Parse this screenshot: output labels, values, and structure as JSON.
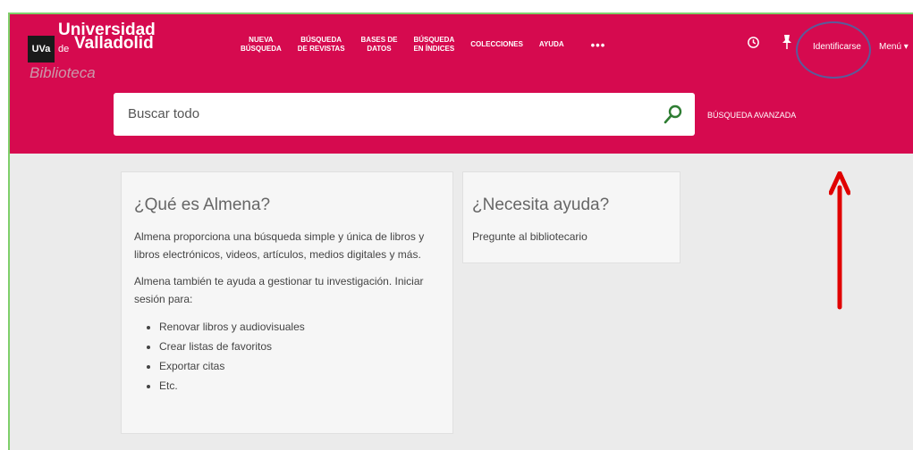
{
  "header": {
    "logo": {
      "uva": "UVa",
      "university_line1": "Universidad",
      "university_de": "de",
      "university_line2": "Valladolid",
      "biblioteca": "Biblioteca"
    },
    "nav": [
      {
        "line1": "NUEVA",
        "line2": "BÚSQUEDA"
      },
      {
        "line1": "BÚSQUEDA",
        "line2": "DE REVISTAS"
      },
      {
        "line1": "BASES DE",
        "line2": "DATOS"
      },
      {
        "line1": "BÚSQUEDA",
        "line2": "EN ÍNDICES"
      },
      {
        "line1": "COLECCIONES",
        "line2": ""
      },
      {
        "line1": "AYUDA",
        "line2": ""
      }
    ],
    "more": "•••",
    "login": "Identificarse",
    "menu": "Menú ▾"
  },
  "search": {
    "placeholder": "Buscar todo",
    "advanced": "BÚSQUEDA AVANZADA"
  },
  "almena": {
    "title": "¿Qué es Almena?",
    "p1": "Almena proporciona una búsqueda simple y única de libros y libros electrónicos, videos, artículos, medios digitales y más.",
    "p2": "Almena también te ayuda a gestionar tu investigación. Iniciar sesión para:",
    "items": [
      "Renovar libros y audiovisuales",
      "Crear listas de favoritos",
      "Exportar citas",
      "Etc."
    ]
  },
  "help": {
    "title": "¿Necesita ayuda?",
    "text": "Pregunte al bibliotecario"
  },
  "colors": {
    "brand": "#d60a4f",
    "background": "#ebebeb",
    "annotation_circle": "#5a5c9a",
    "annotation_arrow": "#e00000",
    "search_icon": "#2e7d32"
  }
}
